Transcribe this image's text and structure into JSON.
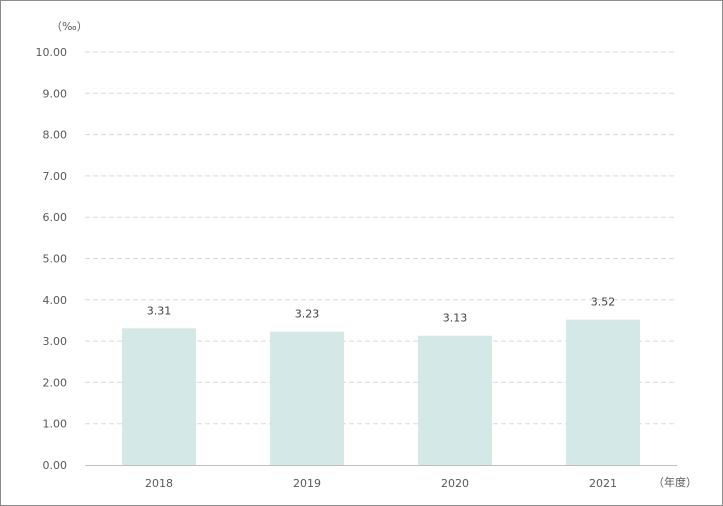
{
  "chart_data": {
    "type": "bar",
    "categories": [
      "2018",
      "2019",
      "2020",
      "2021"
    ],
    "values": [
      3.31,
      3.23,
      3.13,
      3.52
    ],
    "data_labels": [
      "3.31",
      "3.23",
      "3.13",
      "3.52"
    ],
    "y_unit": "（‰）",
    "x_unit": "（年度）",
    "ylim": [
      0,
      10
    ],
    "y_ticks": [
      "0.00",
      "1.00",
      "2.00",
      "3.00",
      "4.00",
      "5.00",
      "6.00",
      "7.00",
      "8.00",
      "9.00",
      "10.00"
    ],
    "grid": true,
    "legend": "none",
    "colors": {
      "bar": "#d5e8e8",
      "grid": "#d9d9d9",
      "axis": "#bfbfbf",
      "text": "#595959"
    }
  }
}
